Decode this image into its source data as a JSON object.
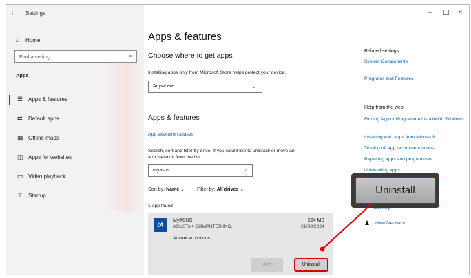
{
  "window": {
    "title": "Settings",
    "back_glyph": "←",
    "controls": {
      "minimize": "–",
      "maximize": "☐",
      "close": "×"
    }
  },
  "sidebar": {
    "home": {
      "icon": "home-icon",
      "glyph": "⌂",
      "label": "Home"
    },
    "search": {
      "placeholder": "Find a setting",
      "icon": "search-icon",
      "glyph": "⌕"
    },
    "section": "Apps",
    "items": [
      {
        "icon": "apps-features-icon",
        "glyph": "☰",
        "label": "Apps & features",
        "active": true
      },
      {
        "icon": "default-apps-icon",
        "glyph": "⇄",
        "label": "Default apps"
      },
      {
        "icon": "offline-maps-icon",
        "glyph": "▦",
        "label": "Offline maps"
      },
      {
        "icon": "apps-websites-icon",
        "glyph": "◫",
        "label": "Apps for websites"
      },
      {
        "icon": "video-playback-icon",
        "glyph": "▭",
        "label": "Video playback"
      },
      {
        "icon": "startup-icon",
        "glyph": "⊤",
        "label": "Startup"
      }
    ]
  },
  "main": {
    "title": "Apps & features",
    "choose_heading": "Choose where to get apps",
    "choose_desc": "Installing apps only from Microsoft Store helps protect your device.",
    "source_select": {
      "value": "Anywhere",
      "chevron": "⌄"
    },
    "section_heading": "Apps & features",
    "aliases_link": "App execution aliases",
    "search_desc_1": "Search, sort and filter by drive. If you would like to uninstall or move an",
    "search_desc_2": "app, select it from the list.",
    "app_search": {
      "value": "myasus",
      "glyph": "⌕"
    },
    "sort": {
      "label": "Sort by:",
      "value": "Name",
      "chevron": "⌄"
    },
    "filter": {
      "label": "Filter by:",
      "value": "All drives",
      "chevron": "⌄"
    },
    "count": "1 app found",
    "app": {
      "icon_glyph": "/A",
      "name": "MyASUS",
      "publisher": "ASUSTeK COMPUTER INC.",
      "size": "224 MB",
      "date": "21/08/2024",
      "advanced": "Advanced options",
      "move_label": "Move",
      "uninstall_label": "Uninstall"
    }
  },
  "related": {
    "heading": "Related settings",
    "links": [
      "System Components",
      "Programs and Features"
    ],
    "help_heading": "Help from the web",
    "help_links": [
      "Finding App or Programme installed in Windows",
      "Installing web apps from Microsoft",
      "Turning off app recommendations",
      "Repairing apps and programmes",
      "Uninstalling apps"
    ],
    "get_help": "Get help",
    "feedback": "Give feedback"
  },
  "callout": {
    "label": "Uninstall"
  },
  "colors": {
    "accent": "#0067b8",
    "highlight": "#e00000",
    "nav_bar": "#0b5cab"
  }
}
